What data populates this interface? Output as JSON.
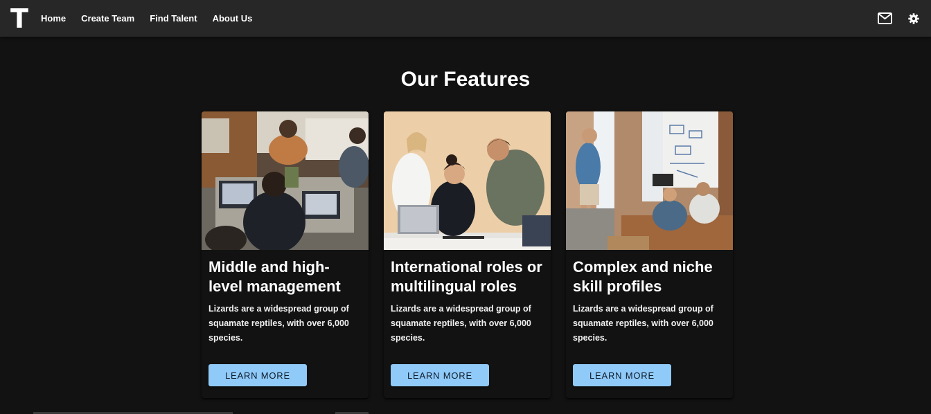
{
  "header": {
    "logo": "T",
    "nav": [
      "Home",
      "Create Team",
      "Find Talent",
      "About Us"
    ],
    "icons": [
      "mail-icon",
      "settings-icon"
    ]
  },
  "main": {
    "title": "Our Features",
    "cards": [
      {
        "title": "Middle and high-level management",
        "text": "Lizards are a widespread group of squamate reptiles, with over 6,000 species.",
        "button": "Learn More"
      },
      {
        "title": "International roles or multilingual roles",
        "text": "Lizards are a widespread group of squamate reptiles, with over 6,000 species.",
        "button": "Learn More"
      },
      {
        "title": "Complex and niche skill profiles",
        "text": "Lizards are a widespread group of squamate reptiles, with over 6,000 species.",
        "button": "Learn More"
      }
    ]
  },
  "colors": {
    "background": "#121212",
    "appbar": "#272727",
    "accent": "#90caf9"
  }
}
